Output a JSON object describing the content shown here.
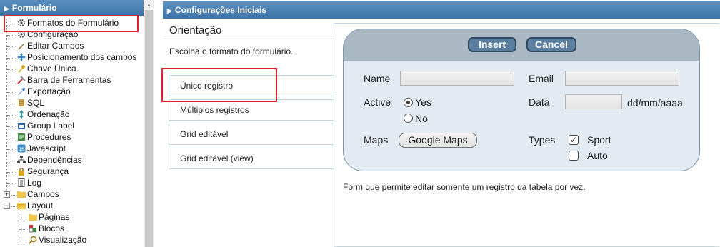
{
  "sidebar": {
    "header": "Formulário",
    "items": [
      {
        "label": "Formatos do Formulário",
        "icon": "gear-icon"
      },
      {
        "label": "Configuração",
        "icon": "gear-icon"
      },
      {
        "label": "Editar Campos",
        "icon": "pencil-icon"
      },
      {
        "label": "Posicionamento dos campos",
        "icon": "move-icon"
      },
      {
        "label": "Chave Única",
        "icon": "key-icon"
      },
      {
        "label": "Barra de Ferramentas",
        "icon": "tools-icon"
      },
      {
        "label": "Exportação",
        "icon": "export-icon"
      },
      {
        "label": "SQL",
        "icon": "database-icon"
      },
      {
        "label": "Ordenação",
        "icon": "sort-icon"
      },
      {
        "label": "Group Label",
        "icon": "group-label-icon"
      },
      {
        "label": "Procedures",
        "icon": "procedures-icon"
      },
      {
        "label": "Javascript",
        "icon": "javascript-icon"
      },
      {
        "label": "Dependências",
        "icon": "dependencies-icon"
      },
      {
        "label": "Segurança",
        "icon": "lock-icon"
      },
      {
        "label": "Log",
        "icon": "log-icon"
      },
      {
        "label": "Campos",
        "icon": "folder-icon"
      },
      {
        "label": "Layout",
        "icon": "folder-icon"
      },
      {
        "label": "Páginas",
        "icon": "folder-icon"
      },
      {
        "label": "Blocos",
        "icon": "blocks-icon"
      },
      {
        "label": "Visualização",
        "icon": "magnifier-icon"
      }
    ]
  },
  "main": {
    "header": "Configurações Iniciais",
    "orientation_title": "Orientação",
    "orientation_desc": "Escolha o formato do formulário.",
    "options": [
      "Único registro",
      "Múltiplos registros",
      "Grid editável",
      "Grid editável (view)"
    ],
    "selected_option": "Único registro",
    "description": "Form que permite editar somente um registro da tabela por vez."
  },
  "preview": {
    "insert_label": "Insert",
    "cancel_label": "Cancel",
    "name_label": "Name",
    "email_label": "Email",
    "active_label": "Active",
    "yes_label": "Yes",
    "no_label": "No",
    "active_value": "Yes",
    "data_label": "Data",
    "date_format": "dd/mm/aaaa",
    "maps_label": "Maps",
    "google_maps_label": "Google Maps",
    "types_label": "Types",
    "sport_label": "Sport",
    "auto_label": "Auto",
    "sport_checked": true,
    "auto_checked": false
  },
  "colors": {
    "header_blue": "#4a7fb3",
    "highlight_red": "#e0202a",
    "button_blue": "#5c7fa0",
    "card_bg": "#e3eaf1"
  }
}
